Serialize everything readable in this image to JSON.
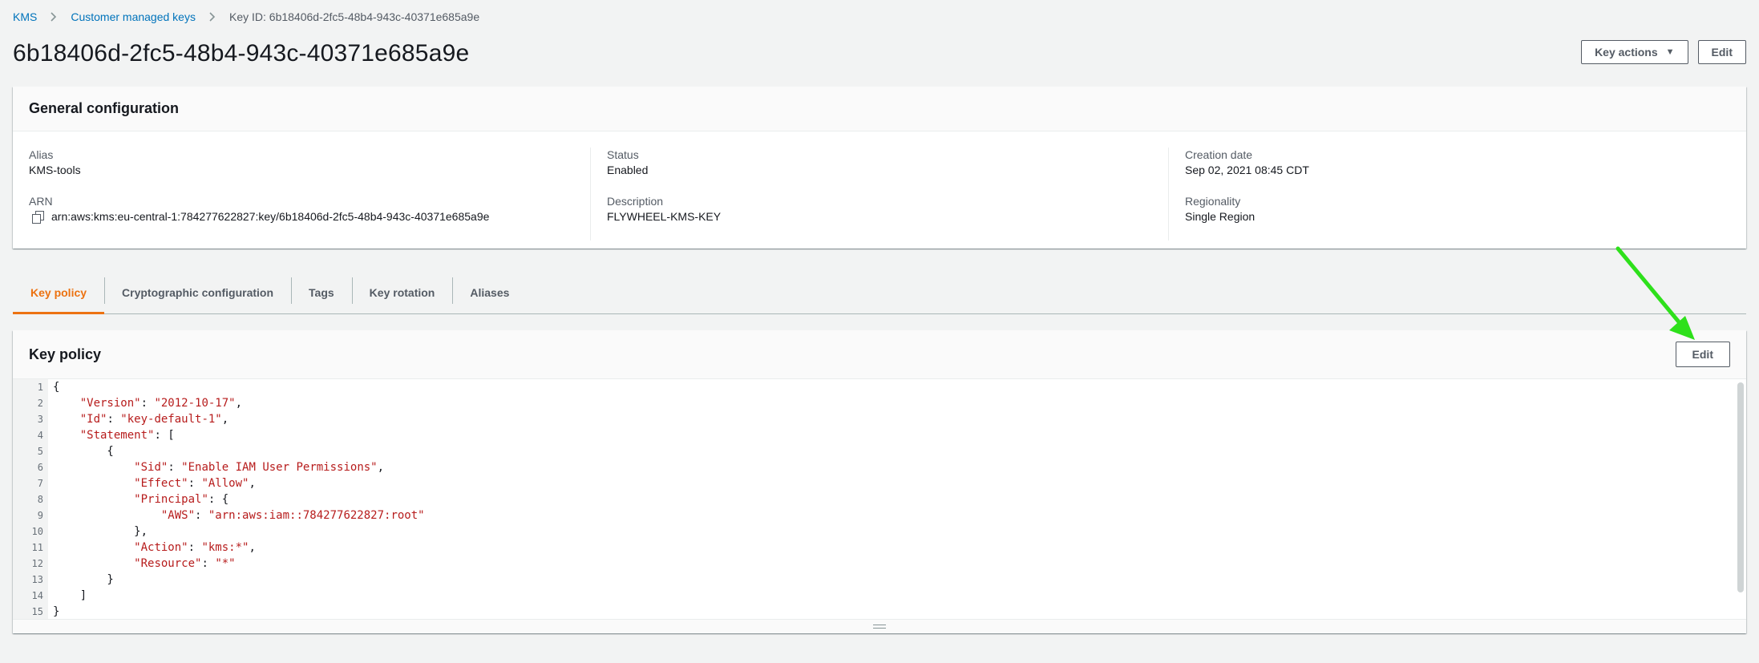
{
  "breadcrumb": {
    "items": [
      "KMS",
      "Customer managed keys"
    ],
    "current": "Key ID: 6b18406d-2fc5-48b4-943c-40371e685a9e"
  },
  "header": {
    "title": "6b18406d-2fc5-48b4-943c-40371e685a9e",
    "key_actions_label": "Key actions",
    "edit_label": "Edit"
  },
  "general": {
    "title": "General configuration",
    "alias_label": "Alias",
    "alias_value": "KMS-tools",
    "arn_label": "ARN",
    "arn_value": "arn:aws:kms:eu-central-1:784277622827:key/6b18406d-2fc5-48b4-943c-40371e685a9e",
    "status_label": "Status",
    "status_value": "Enabled",
    "description_label": "Description",
    "description_value": "FLYWHEEL-KMS-KEY",
    "creation_label": "Creation date",
    "creation_value": "Sep 02, 2021 08:45 CDT",
    "regionality_label": "Regionality",
    "regionality_value": "Single Region"
  },
  "tabs": [
    {
      "label": "Key policy",
      "active": true
    },
    {
      "label": "Cryptographic configuration",
      "active": false
    },
    {
      "label": "Tags",
      "active": false
    },
    {
      "label": "Key rotation",
      "active": false
    },
    {
      "label": "Aliases",
      "active": false
    }
  ],
  "key_policy": {
    "title": "Key policy",
    "edit_label": "Edit",
    "lines": [
      "{",
      "    \"Version\": \"2012-10-17\",",
      "    \"Id\": \"key-default-1\",",
      "    \"Statement\": [",
      "        {",
      "            \"Sid\": \"Enable IAM User Permissions\",",
      "            \"Effect\": \"Allow\",",
      "            \"Principal\": {",
      "                \"AWS\": \"arn:aws:iam::784277622827:root\"",
      "            },",
      "            \"Action\": \"kms:*\",",
      "            \"Resource\": \"*\"",
      "        }",
      "    ]",
      "}"
    ]
  },
  "colors": {
    "link": "#0073bb",
    "active_tab": "#ec7211",
    "json_string": "#b71c1c",
    "annotation_arrow": "#2ee01b"
  }
}
